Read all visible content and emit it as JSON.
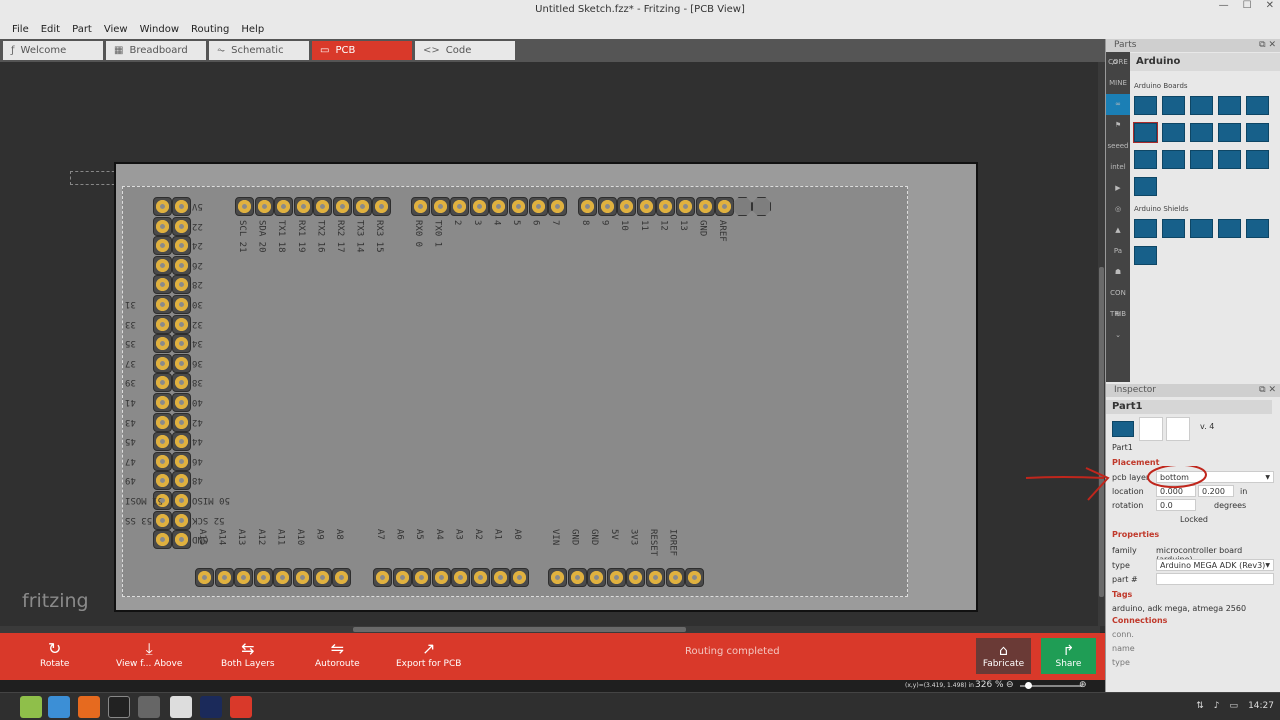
{
  "window": {
    "title": "Untitled Sketch.fzz* - Fritzing - [PCB View]"
  },
  "menu": [
    "File",
    "Edit",
    "Part",
    "View",
    "Window",
    "Routing",
    "Help"
  ],
  "tabs": [
    {
      "label": "Welcome",
      "icon": "f-logo-icon"
    },
    {
      "label": "Breadboard",
      "icon": "breadboard-icon"
    },
    {
      "label": "Schematic",
      "icon": "schematic-icon"
    },
    {
      "label": "PCB",
      "icon": "pcb-icon"
    },
    {
      "label": "Code",
      "icon": "code-icon"
    }
  ],
  "board": {
    "top_labels_a": [
      "SCL 21",
      "SDA 20",
      "TX1 18",
      "RX1 19",
      "TX2 16",
      "RX2 17",
      "TX3 14",
      "RX3 15"
    ],
    "top_labels_b": [
      "RX0 0",
      "TX0 1",
      "2",
      "3",
      "4",
      "5",
      "6",
      "7"
    ],
    "top_labels_c": [
      "8",
      "9",
      "10",
      "11",
      "12",
      "13",
      "GND",
      "AREF"
    ],
    "right_col": [
      "5V",
      "22",
      "24",
      "26",
      "28",
      "30",
      "32",
      "34",
      "36",
      "38",
      "40",
      "42",
      "44",
      "46",
      "48",
      "50 MISO",
      "52 SCK",
      "GND"
    ],
    "left_col": [
      "31",
      "33",
      "35",
      "37",
      "39",
      "41",
      "43",
      "45",
      "47",
      "49",
      "51 MOSI",
      "53 SS"
    ],
    "bottom_labels_a": [
      "A15",
      "A14",
      "A13",
      "A12",
      "A11",
      "A10",
      "A9",
      "A8"
    ],
    "bottom_labels_b": [
      "A7",
      "A6",
      "A5",
      "A4",
      "A3",
      "A2",
      "A1",
      "A0"
    ],
    "bottom_labels_c": [
      "VIN",
      "GND",
      "GND",
      "5V",
      "3V3",
      "RESET",
      "IOREF"
    ],
    "logo": "fritzing"
  },
  "toolbar": {
    "rotate": "Rotate",
    "view": "View f... Above",
    "layers": "Both Layers",
    "autoroute": "Autoroute",
    "export": "Export for PCB",
    "status": "Routing completed",
    "fabricate": "Fabricate",
    "share": "Share"
  },
  "statusbar": {
    "coords": "(x,y)=(3.419, 1.498) in",
    "zoom": "326 %",
    "zoom_out": "⊖",
    "zoom_in": "⊕"
  },
  "parts": {
    "title": "Parts",
    "search": "Arduino",
    "boards": "Arduino Boards",
    "shields": "Arduino Shields",
    "sidebar": [
      "CORE",
      "MINE",
      "∞",
      "⚑",
      "seeed",
      "intel",
      "▶",
      "◎",
      "▲",
      "Pa",
      "☗",
      "CON TRIB",
      "⊕",
      "⌄"
    ]
  },
  "inspector": {
    "title": "Inspector",
    "part": "Part1",
    "version": "v. 4",
    "caption": "Part1",
    "placement": "Placement",
    "pcb_layer_label": "pcb layer",
    "pcb_layer": "bottom",
    "location_label": "location",
    "loc_x": "0.000",
    "loc_y": "0.200",
    "loc_unit": "in",
    "rotation_label": "rotation",
    "rotation": "0.0",
    "rotation_unit": "degrees",
    "locked": "Locked",
    "properties": "Properties",
    "family_label": "family",
    "family": "microcontroller board (arduino)",
    "type_label": "type",
    "type": "Arduino MEGA ADK (Rev3)",
    "partno_label": "part #",
    "tags": "Tags",
    "tags_value": "arduino, adk mega, atmega 2560",
    "connections": "Connections",
    "conn": "conn.",
    "name": "name",
    "type2": "type"
  },
  "tray": {
    "time": "14:27"
  },
  "colors": {
    "accent": "#d9392a",
    "share": "#1f9d55",
    "pad": "#f0c65a"
  }
}
